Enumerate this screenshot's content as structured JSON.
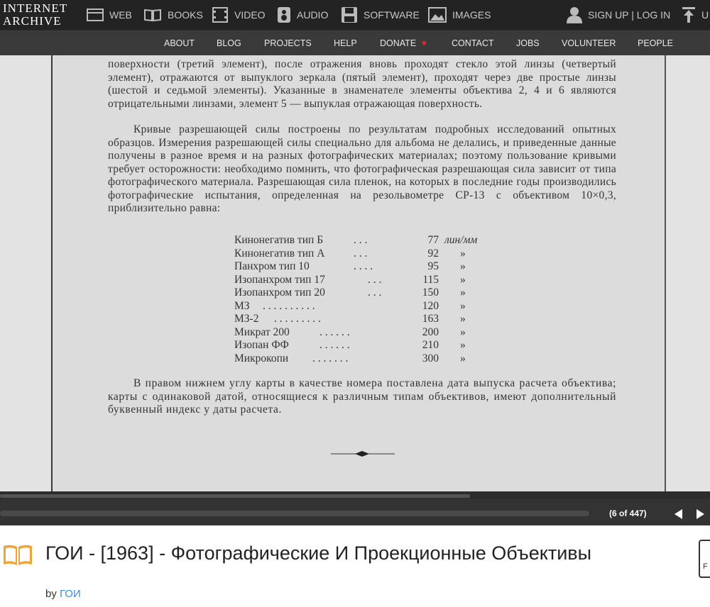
{
  "topnav": {
    "logo_line1": "INTERNET",
    "logo_line2": "ARCHIVE",
    "items": [
      {
        "label": "WEB",
        "icon": "web-icon"
      },
      {
        "label": "BOOKS",
        "icon": "books-icon"
      },
      {
        "label": "VIDEO",
        "icon": "video-icon"
      },
      {
        "label": "AUDIO",
        "icon": "audio-icon"
      },
      {
        "label": "SOFTWARE",
        "icon": "software-icon"
      },
      {
        "label": "IMAGES",
        "icon": "images-icon"
      }
    ],
    "signin": "SIGN UP | LOG IN",
    "upload": "U"
  },
  "subnav": {
    "items": [
      "ABOUT",
      "BLOG",
      "PROJECTS",
      "HELP",
      "DONATE",
      "CONTACT",
      "JOBS",
      "VOLUNTEER",
      "PEOPLE"
    ],
    "donate_heart_color": "#e12a2a"
  },
  "scan": {
    "para1": "поверхности (третий элемент), после отражения вновь проходят стекло этой линзы (четвертый элемент), отражаются от выпуклого зеркала (пятый элемент), проходят через две простые линзы (шестой и седьмой элементы). Указанные в знаменателе элементы объектива 2, 4 и 6 являются отрицательными линзами, элемент 5 — выпуклая отражающая поверхность.",
    "para2": "Кривые разрешающей силы построены по результатам подробных исследований опытных образцов. Измерения разрешающей силы специально для альбома не делались, и приведенные данные получены в разное время и на разных фотографических материалах; поэтому пользование кривыми требует осторожности: необходимо помнить, что фотографическая разрешающая сила зависит от типа фотографического материала. Разрешающая сила пленок, на которых в последние годы производились фотографические испытания, определенная на резольвометре СР-13 с объективом 10×0,3, приблизительно равна:",
    "table": [
      {
        "name": "Кинонегатив тип Б",
        "value": "77",
        "unit": "лин/мм"
      },
      {
        "name": "Кинонегатив тип А",
        "value": "92",
        "unit": "»"
      },
      {
        "name": "Панхром тип 10",
        "value": "95",
        "unit": "»"
      },
      {
        "name": "Изопанхром тип 17",
        "value": "115",
        "unit": "»"
      },
      {
        "name": "Изопанхром тип 20",
        "value": "150",
        "unit": "»"
      },
      {
        "name": "МЗ",
        "value": "120",
        "unit": "»"
      },
      {
        "name": "МЗ-2",
        "value": "163",
        "unit": "»"
      },
      {
        "name": "Микрат 200",
        "value": "200",
        "unit": "»"
      },
      {
        "name": "Изопан ФФ",
        "value": "210",
        "unit": "»"
      },
      {
        "name": "Микрокопи",
        "value": "300",
        "unit": "»"
      }
    ],
    "para3": "В правом нижнем углу карты в качестве номера поставлена дата выпуска расчета объектива; карты с одинаковой датой, относящиеся к различным типам объективов, имеют дополнительный буквенный индекс у даты расчета."
  },
  "viewer": {
    "page_indicator": "(6 of 447)",
    "progress_fraction": 0.662
  },
  "item": {
    "title": "ГОИ - [1963] - Фотографические И Проекционные Объективы",
    "by_label": "by",
    "author": "ГОИ",
    "right_box_text": "F"
  }
}
